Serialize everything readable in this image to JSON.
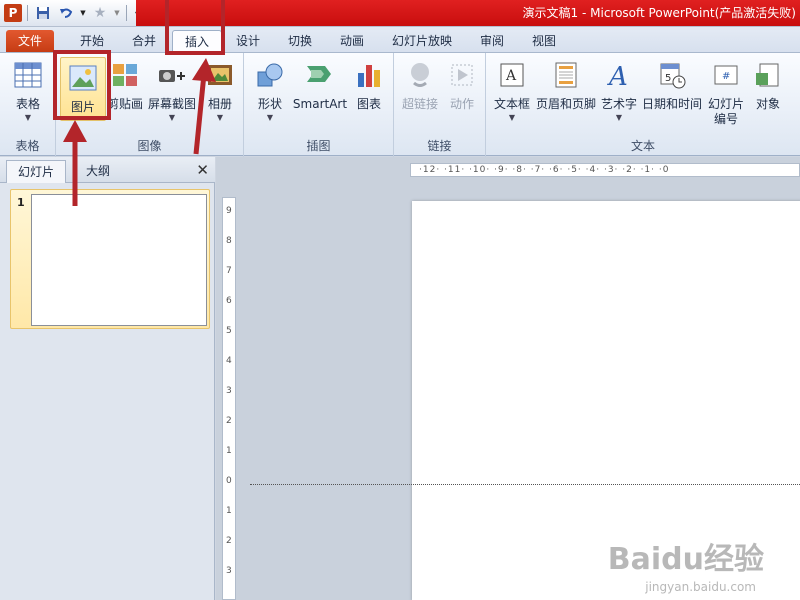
{
  "window": {
    "title": "演示文稿1 - Microsoft PowerPoint(产品激活失败)",
    "app_logo": "P"
  },
  "tabs": [
    {
      "label": "文件"
    },
    {
      "label": "开始"
    },
    {
      "label": "合并"
    },
    {
      "label": "插入"
    },
    {
      "label": "设计"
    },
    {
      "label": "切换"
    },
    {
      "label": "动画"
    },
    {
      "label": "幻灯片放映"
    },
    {
      "label": "审阅"
    },
    {
      "label": "视图"
    }
  ],
  "ribbon": {
    "groups": [
      {
        "label": "表格"
      },
      {
        "label": "图像"
      },
      {
        "label": "插图"
      },
      {
        "label": "链接"
      },
      {
        "label": "文本"
      }
    ],
    "buttons": [
      {
        "label": "表格",
        "icon": "table-icon"
      },
      {
        "label": "图片",
        "icon": "picture-icon"
      },
      {
        "label": "剪贴画",
        "icon": "clipart-icon"
      },
      {
        "label": "屏幕截图",
        "icon": "screenshot-icon"
      },
      {
        "label": "相册",
        "icon": "album-icon"
      },
      {
        "label": "形状",
        "icon": "shapes-icon"
      },
      {
        "label": "SmartArt",
        "icon": "smartart-icon"
      },
      {
        "label": "图表",
        "icon": "chart-icon"
      },
      {
        "label": "超链接",
        "icon": "hyperlink-icon"
      },
      {
        "label": "动作",
        "icon": "action-icon"
      },
      {
        "label": "文本框",
        "icon": "textbox-icon"
      },
      {
        "label": "页眉和页脚",
        "icon": "header-footer-icon"
      },
      {
        "label": "艺术字",
        "icon": "wordart-icon"
      },
      {
        "label": "日期和时间",
        "icon": "datetime-icon"
      },
      {
        "label": "幻灯片\n编号",
        "icon": "slide-number-icon"
      },
      {
        "label": "对象",
        "icon": "object-icon"
      }
    ]
  },
  "left_pane": {
    "tabs": [
      "幻灯片",
      "大纲"
    ],
    "slide_number": "1"
  },
  "ruler": {
    "horizontal": "·12· ·11· ·10· ·9· ·8· ·7· ·6· ·5· ·4· ·3· ·2· ·1· ·0",
    "vertical": [
      "9",
      "8",
      "7",
      "6",
      "5",
      "4",
      "3",
      "2",
      "1",
      "0",
      "1",
      "2",
      "3"
    ]
  },
  "watermark": {
    "text": "Baidu经验",
    "sub": "jingyan.baidu.com"
  },
  "colors": {
    "annotation": "#b3252a",
    "title_bar": "#d81818",
    "file_tab": "#d44a22"
  }
}
